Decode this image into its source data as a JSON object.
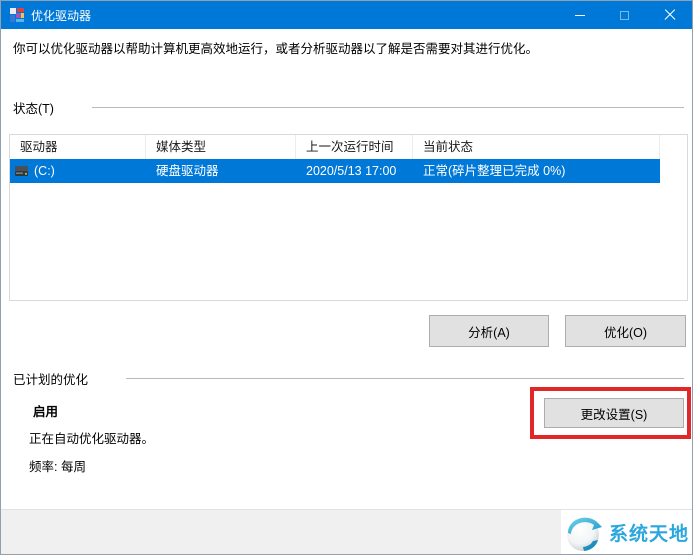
{
  "window": {
    "title": "优化驱动器"
  },
  "description": "你可以优化驱动器以帮助计算机更高效地运行，或者分析驱动器以了解是否需要对其进行优化。",
  "status_section": {
    "label": "状态(T)",
    "table": {
      "columns": [
        "驱动器",
        "媒体类型",
        "上一次运行时间",
        "当前状态"
      ],
      "rows": [
        {
          "drive": "(C:)",
          "media_type": "硬盘驱动器",
          "last_run": "2020/5/13 17:00",
          "current_status": "正常(碎片整理已完成 0%)",
          "selected": true
        }
      ]
    },
    "buttons": {
      "analyze": "分析(A)",
      "optimize": "优化(O)"
    }
  },
  "scheduled_section": {
    "label": "已计划的优化",
    "state": "启用",
    "description": "正在自动优化驱动器。",
    "frequency": "频率: 每周",
    "change_settings": "更改设置(S)"
  },
  "watermark": {
    "text": "系统天地"
  },
  "colors": {
    "titlebar": "#0078D7",
    "selection": "#0078D7",
    "button_face": "#E1E1E1",
    "annotation": "#E12828",
    "watermark_text": "#2BA7DD",
    "footer": "#F0F0F0"
  }
}
